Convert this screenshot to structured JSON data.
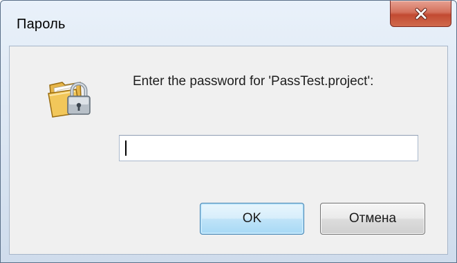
{
  "window": {
    "title": "Пароль"
  },
  "dialog": {
    "prompt": "Enter the password for 'PassTest.project':",
    "password_value": "",
    "ok_label": "OK",
    "cancel_label": "Отмена"
  },
  "icons": {
    "close": "close-icon",
    "dialog": "folder-lock-icon"
  },
  "colors": {
    "title_bar": "#dce7f4",
    "close_button": "#c85a43",
    "client_bg": "#f0f0f0",
    "ok_border": "#3c7fb1"
  }
}
